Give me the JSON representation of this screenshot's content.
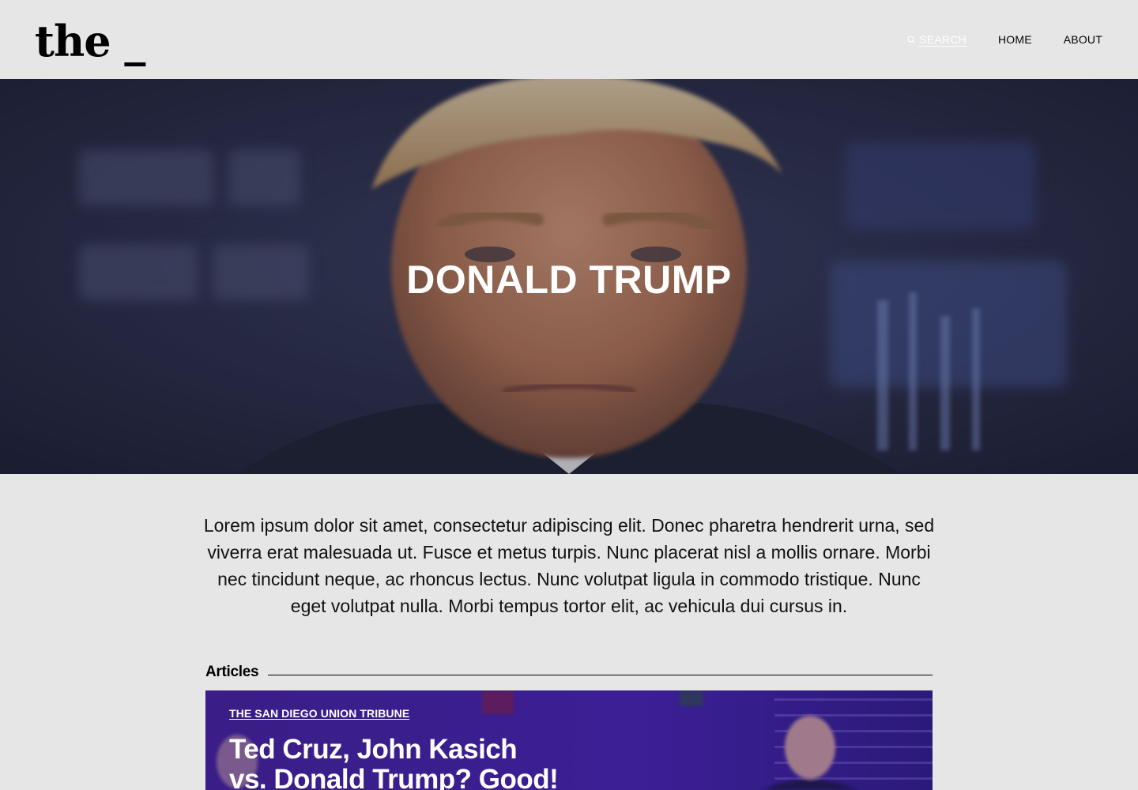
{
  "header": {
    "logo": "the _",
    "nav": {
      "search_label": "SEARCH",
      "home_label": "HOME",
      "about_label": "ABOUT"
    }
  },
  "hero": {
    "title": "DONALD TRUMP"
  },
  "intro": {
    "text": "Lorem ipsum dolor sit amet, consectetur adipiscing elit. Donec pharetra hendrerit urna, sed viverra erat malesuada ut. Fusce et metus turpis. Nunc placerat nisl a mollis ornare. Morbi nec tincidunt neque, ac rhoncus lectus. Nunc volutpat ligula in commodo tristique. Nunc eget volutpat nulla. Morbi tempus tortor elit, ac vehicula dui cursus in."
  },
  "articles": {
    "label": "Articles",
    "items": [
      {
        "source": "THE SAN DIEGO UNION TRIBUNE",
        "title": "Ted Cruz, John Kasich vs. Donald Trump? Good!"
      }
    ]
  },
  "colors": {
    "background": "#e6e6e6",
    "text": "#000000",
    "hero_text": "#ffffff",
    "card_tint": "#2d1a7a"
  }
}
